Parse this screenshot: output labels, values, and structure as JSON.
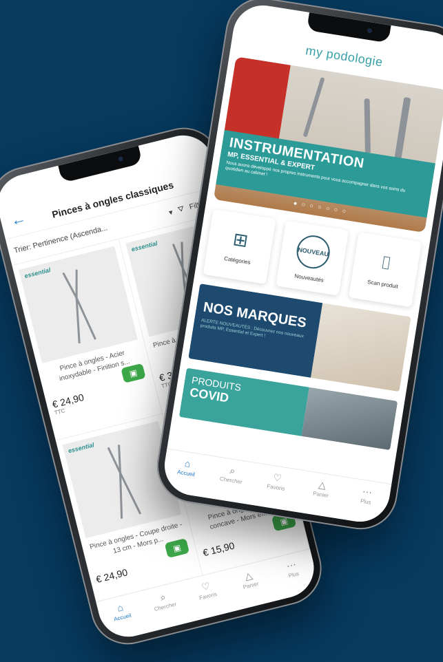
{
  "left_phone": {
    "header": {
      "back_icon": "arrow-left-icon",
      "title": "Pinces à ongles classiques"
    },
    "sortbar": {
      "sort_label": "Trier: Pertinence (Ascenda...",
      "filter_label": "Filtre"
    },
    "products": [
      {
        "brand": "essential",
        "name": "Pince à ongles - Acier inoxydable - Finition s...",
        "price": "€ 24,90",
        "tax": "TTC"
      },
      {
        "brand": "essential",
        "name": "Pince à ongles - Coupe droite - M...",
        "price": "€ 31",
        "tax": "TTC"
      },
      {
        "brand": "essential",
        "name": "Pince à ongles - Coupe droite - 13 cm - Mors p...",
        "price": "€ 24,90",
        "tax": ""
      },
      {
        "brand": "",
        "name": "Pince à ongles - Coupe concave - Mors effilés...",
        "price": "€ 15,90",
        "tax": ""
      }
    ],
    "tabs": [
      {
        "label": "Accueil",
        "icon": "home-icon"
      },
      {
        "label": "Chercher",
        "icon": "search-icon"
      },
      {
        "label": "Favoris",
        "icon": "heart-icon"
      },
      {
        "label": "Panier",
        "icon": "bag-icon"
      },
      {
        "label": "Plus",
        "icon": "more-icon"
      }
    ]
  },
  "right_phone": {
    "logo": "my podologie",
    "banner": {
      "title": "INSTRUMENTATION",
      "subtitle": "MP, ESSENTIAL & EXPERT",
      "description": "Nous avons développé nos propres instruments pour vous accompagner dans vos soins du quotidien au cabinet !",
      "dots": "● ○ ○ ○ ○ ○ ○"
    },
    "quick_links": [
      {
        "label": "Catégories",
        "icon": "grid-icon"
      },
      {
        "label": "Nouveautés",
        "icon": "new-badge-icon",
        "badge": "NOUVEAU"
      },
      {
        "label": "Scan produit",
        "icon": "camera-icon"
      }
    ],
    "marques": {
      "title": "NOS MARQUES",
      "subtitle": "ALERTE NOUVEAUTÉS : Découvrez nos nouveaux produits MP, Essential et Expert !"
    },
    "covid": {
      "line1": "PRODUITS",
      "line2": "COVID"
    },
    "tabs": [
      {
        "label": "Accueil",
        "icon": "home-icon"
      },
      {
        "label": "Chercher",
        "icon": "search-icon"
      },
      {
        "label": "Favoris",
        "icon": "heart-icon"
      },
      {
        "label": "Panier",
        "icon": "bag-icon"
      },
      {
        "label": "Plus",
        "icon": "more-icon"
      }
    ]
  },
  "colors": {
    "background": "#063a5f",
    "accent": "#2c9b98",
    "active_tab": "#1f78c8",
    "cart_button": "#3da84a"
  }
}
